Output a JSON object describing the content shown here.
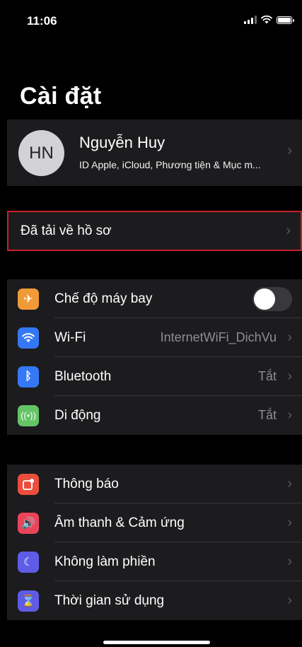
{
  "status": {
    "time": "11:06"
  },
  "page_title": "Cài đặt",
  "profile": {
    "initials": "HN",
    "name": "Nguyễn Huy",
    "subtitle": "ID Apple, iCloud, Phương tiện & Mục m..."
  },
  "downloaded_profile": {
    "label": "Đã tải về hồ sơ"
  },
  "connectivity": [
    {
      "label": "Chế độ máy bay",
      "icon": "airplane-icon",
      "icon_color": "#f09a37",
      "toggle_on": false
    },
    {
      "label": "Wi-Fi",
      "value": "InternetWiFi_DichVu",
      "icon": "wifi-icon",
      "icon_color": "#3478f6"
    },
    {
      "label": "Bluetooth",
      "value": "Tắt",
      "icon": "bluetooth-icon",
      "icon_color": "#3478f6"
    },
    {
      "label": "Di động",
      "value": "Tắt",
      "icon": "cellular-icon",
      "icon_color": "#65c466"
    }
  ],
  "notifications": [
    {
      "label": "Thông báo",
      "icon": "notifications-icon",
      "icon_color": "#eb4e3d"
    },
    {
      "label": "Âm thanh & Cảm ứng",
      "icon": "sound-icon",
      "icon_color": "#eb445a"
    },
    {
      "label": "Không làm phiền",
      "icon": "moon-icon",
      "icon_color": "#5e5ce6"
    },
    {
      "label": "Thời gian sử dụng",
      "icon": "hourglass-icon",
      "icon_color": "#5e5ce6"
    }
  ]
}
